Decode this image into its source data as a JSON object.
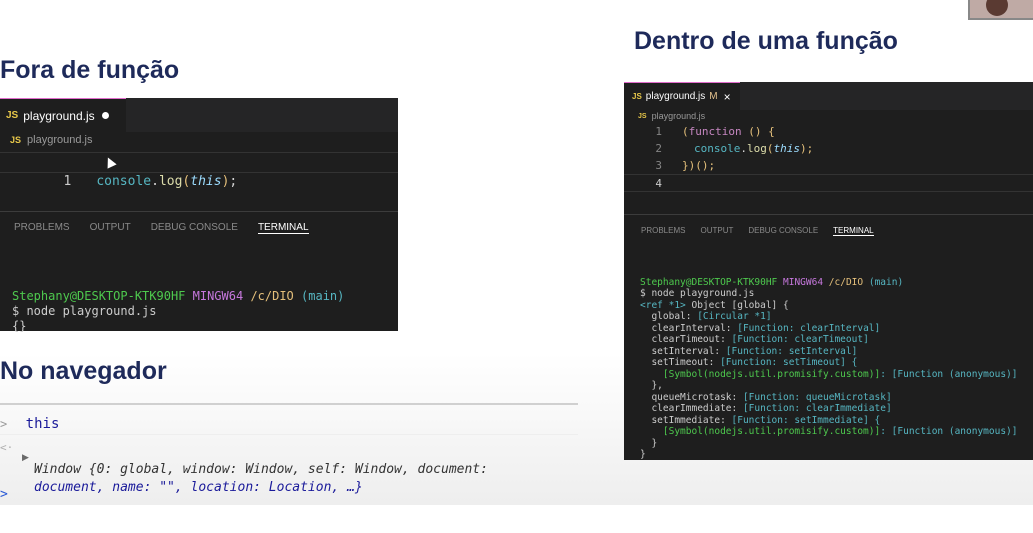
{
  "left": {
    "heading": "Fora de função",
    "editor": {
      "tab_lang": "JS",
      "tab_label": "playground.js",
      "breadcrumb": "playground.js",
      "line_number": "1",
      "code_object": "console",
      "code_method": "log",
      "code_arg": "this",
      "code_tail": ";"
    },
    "panel_tabs": [
      "PROBLEMS",
      "OUTPUT",
      "DEBUG CONSOLE",
      "TERMINAL"
    ],
    "terminal": {
      "prompt_user": "Stephany@DESKTOP-KTK90HF",
      "prompt_env": "MINGW64",
      "prompt_path": "/c/DIO",
      "prompt_branch": "(main)",
      "command": "$ node playground.js",
      "output": "{}"
    }
  },
  "browser": {
    "heading": "No navegador",
    "input_prompt": ">",
    "input": "this",
    "result_prompt": "<·",
    "expand_arrow": "▶",
    "result_line1": "Window {0: global, window: Window, self: Window, document:",
    "result_line2": "document, name: \"\", location: Location, …}",
    "next_prompt": ">"
  },
  "right": {
    "heading": "Dentro de uma função",
    "editor": {
      "tab_lang": "JS",
      "tab_label": "playground.js",
      "tab_status": "M",
      "tab_close": "×",
      "breadcrumb": "playground.js",
      "line_numbers": [
        "1",
        "2",
        "3",
        "4"
      ],
      "line1_open": "(",
      "line1_keyword": "function",
      "line1_rest": " () {",
      "line2_object": "console",
      "line2_method": "log",
      "line2_arg": "this",
      "line2_tail": ");",
      "line3": "})();"
    },
    "panel_tabs": [
      "PROBLEMS",
      "OUTPUT",
      "DEBUG CONSOLE",
      "TERMINAL"
    ],
    "terminal": {
      "prompt_user": "Stephany@DESKTOP-KTK90HF",
      "prompt_env": "MINGW64",
      "prompt_path": "/c/DIO",
      "prompt_branch": "(main)",
      "command": "$ node playground.js",
      "line1_ref": "<ref *1>",
      "line1_rest": " Object [global] {",
      "global_key": "  global: ",
      "global_val": "[Circular *1]",
      "entries": [
        {
          "key": "  clearInterval: ",
          "val": "[Function: clearInterval]"
        },
        {
          "key": "  clearTimeout: ",
          "val": "[Function: clearTimeout]"
        },
        {
          "key": "  setInterval: ",
          "val": "[Function: setInterval]"
        },
        {
          "key": "  setTimeout: ",
          "val": "[Function: setTimeout] {"
        }
      ],
      "symbol_line1_sym": "    [Symbol(nodejs.util.promisify.custom)]",
      "symbol_line1_val": ": [Function (anonymous)]",
      "close_obj1": "  },",
      "entries2": [
        {
          "key": "  queueMicrotask: ",
          "val": "[Function: queueMicrotask]"
        },
        {
          "key": "  clearImmediate: ",
          "val": "[Function: clearImmediate]"
        },
        {
          "key": "  setImmediate: ",
          "val": "[Function: setImmediate] {"
        }
      ],
      "symbol_line2_sym": "    [Symbol(nodejs.util.promisify.custom)]",
      "symbol_line2_val": ": [Function (anonymous)]",
      "close_obj2": "  }",
      "close_global": "}"
    }
  },
  "colors": {
    "heading": "#1e2a5a",
    "editor_bg": "#1e1e1e",
    "tab_accent": "#e06ccb",
    "js_icon": "#e8c84a",
    "terminal_green": "#4ec94e",
    "terminal_purple": "#c678dd",
    "terminal_yellow": "#e5c07b",
    "terminal_cyan": "#56b6c2"
  }
}
